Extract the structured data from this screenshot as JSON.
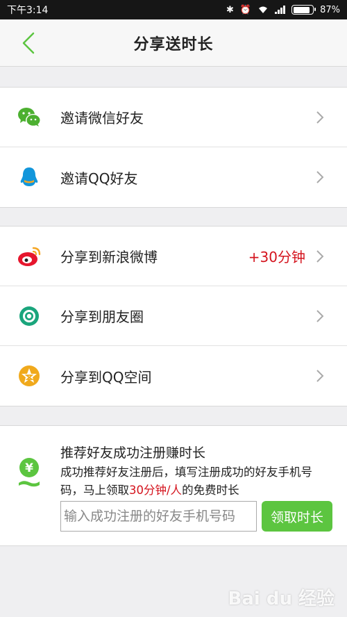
{
  "status_bar": {
    "time": "下午3:14",
    "battery_text": "87%",
    "battery_level": 0.87
  },
  "header": {
    "title": "分享送时长"
  },
  "invite_group": {
    "items": [
      {
        "label": "邀请微信好友",
        "icon": "wechat-icon"
      },
      {
        "label": "邀请QQ好友",
        "icon": "qq-icon"
      }
    ]
  },
  "share_group": {
    "items": [
      {
        "label": "分享到新浪微博",
        "bonus": "+30分钟",
        "icon": "weibo-icon"
      },
      {
        "label": "分享到朋友圈",
        "icon": "moments-icon"
      },
      {
        "label": "分享到QQ空间",
        "icon": "qzone-icon"
      }
    ]
  },
  "referral": {
    "title": "推荐好友成功注册赚时长",
    "desc_before": "成功推荐好友注册后，填写注册成功的好友手机号码，马上领取",
    "desc_highlight": "30分钟/人",
    "desc_after": "的免费时长",
    "input_placeholder": "输入成功注册的好友手机号码",
    "button_label": "领取时长"
  },
  "watermark": "Bai du 经验",
  "colors": {
    "accent_green": "#5cc540",
    "highlight_red": "#d4131d",
    "wechat_green": "#4cb030",
    "qq_blue": "#1296db",
    "weibo_red": "#e6162d",
    "moments_teal": "#1aa57c",
    "qzone_gold": "#f0a91c"
  }
}
